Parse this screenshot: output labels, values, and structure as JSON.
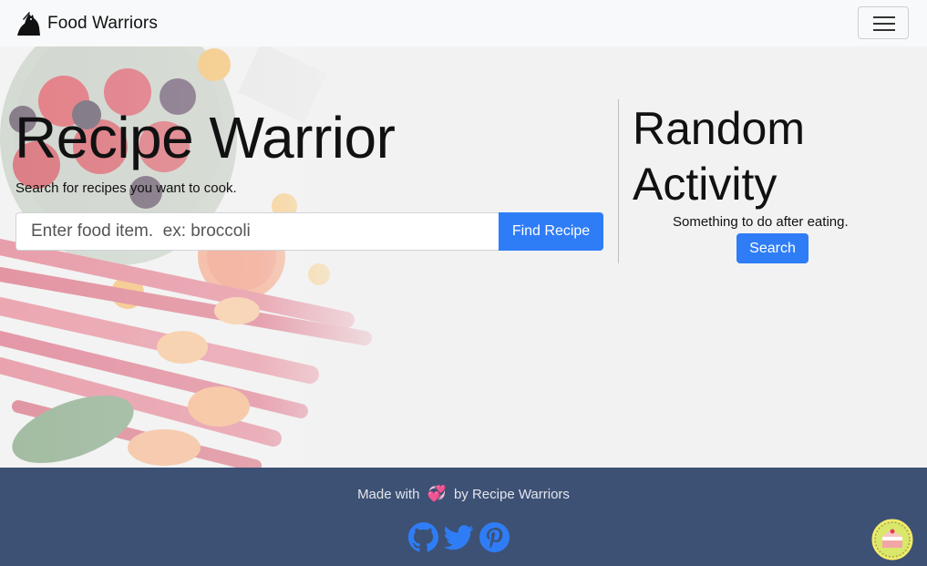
{
  "navbar": {
    "brand": "Food Warriors",
    "menu_icon": "hamburger-menu-icon"
  },
  "hero": {
    "title": "Recipe Warrior",
    "subtitle": "Search for recipes you want to cook.",
    "search_placeholder": "Enter food item.  ex: broccoli",
    "find_button": "Find Recipe"
  },
  "random": {
    "title_line1": "Random",
    "title_line2": "Activity",
    "subtitle": "Something to do after eating.",
    "search_button": "Search"
  },
  "footer": {
    "made_prefix": "Made with",
    "heart_icon": "💞",
    "made_suffix": "by Recipe Warriors",
    "social_icons": [
      "github-icon",
      "twitter-icon",
      "pinterest-icon"
    ]
  },
  "colors": {
    "primary": "#2f7df6",
    "footer_bg": "#3d5175",
    "navbar_bg": "#f8f9fa"
  }
}
